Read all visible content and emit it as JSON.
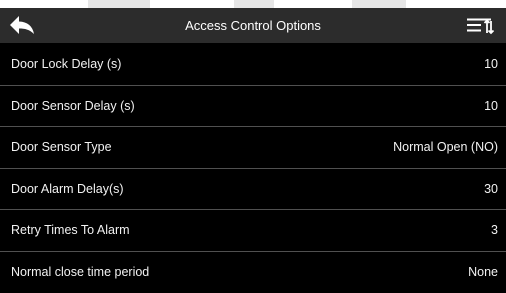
{
  "header": {
    "title": "Access Control Options",
    "back_icon": "back-arrow-icon",
    "menu_icon": "sort-menu-icon"
  },
  "colors": {
    "background": "#000000",
    "header": "#2c2c2c",
    "divider": "#505050",
    "text": "#f2f2f2"
  },
  "settings": [
    {
      "label": "Door Lock Delay (s)",
      "value": "10"
    },
    {
      "label": "Door Sensor Delay (s)",
      "value": "10"
    },
    {
      "label": "Door Sensor Type",
      "value": "Normal Open (NO)"
    },
    {
      "label": "Door Alarm Delay(s)",
      "value": "30"
    },
    {
      "label": "Retry Times To Alarm",
      "value": "3"
    },
    {
      "label": "Normal close time period",
      "value": "None"
    }
  ]
}
